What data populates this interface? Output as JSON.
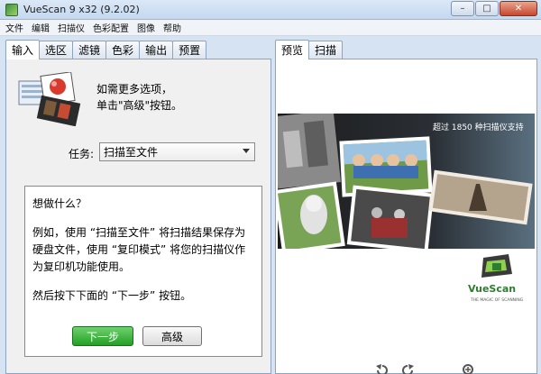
{
  "window": {
    "title": "VueScan 9 x32 (9.2.02)",
    "minimize": "–",
    "maximize": "□",
    "close": "✕"
  },
  "menu": [
    "文件",
    "编辑",
    "扫描仪",
    "色彩配置",
    "图像",
    "帮助"
  ],
  "left_tabs": [
    "输入",
    "选区",
    "滤镜",
    "色彩",
    "输出",
    "预置"
  ],
  "right_tabs": [
    "预览",
    "扫描"
  ],
  "hint": {
    "line1": "如需更多选项，",
    "line2": "单击\"高级\"按钮。"
  },
  "task": {
    "label": "任务:",
    "value": "扫描至文件"
  },
  "description": {
    "p1": "想做什么？",
    "p2": "例如，使用 “扫描至文件” 将扫描结果保存为硬盘文件，使用 “复印模式” 将您的扫描仪作为复印机功能使用。",
    "p3": "然后按下下面的 “下一步” 按钮。"
  },
  "buttons": {
    "next": "下一步",
    "advanced": "高级"
  },
  "preview": {
    "banner": "超过 1850 种扫描仪支持",
    "logo_text": "VueScan",
    "logo_tagline": "THE MAGIC OF SCANNING"
  },
  "colors": {
    "accent_green": "#23a023",
    "titlebar": "#c4d8ef",
    "close_red": "#c8462c"
  }
}
